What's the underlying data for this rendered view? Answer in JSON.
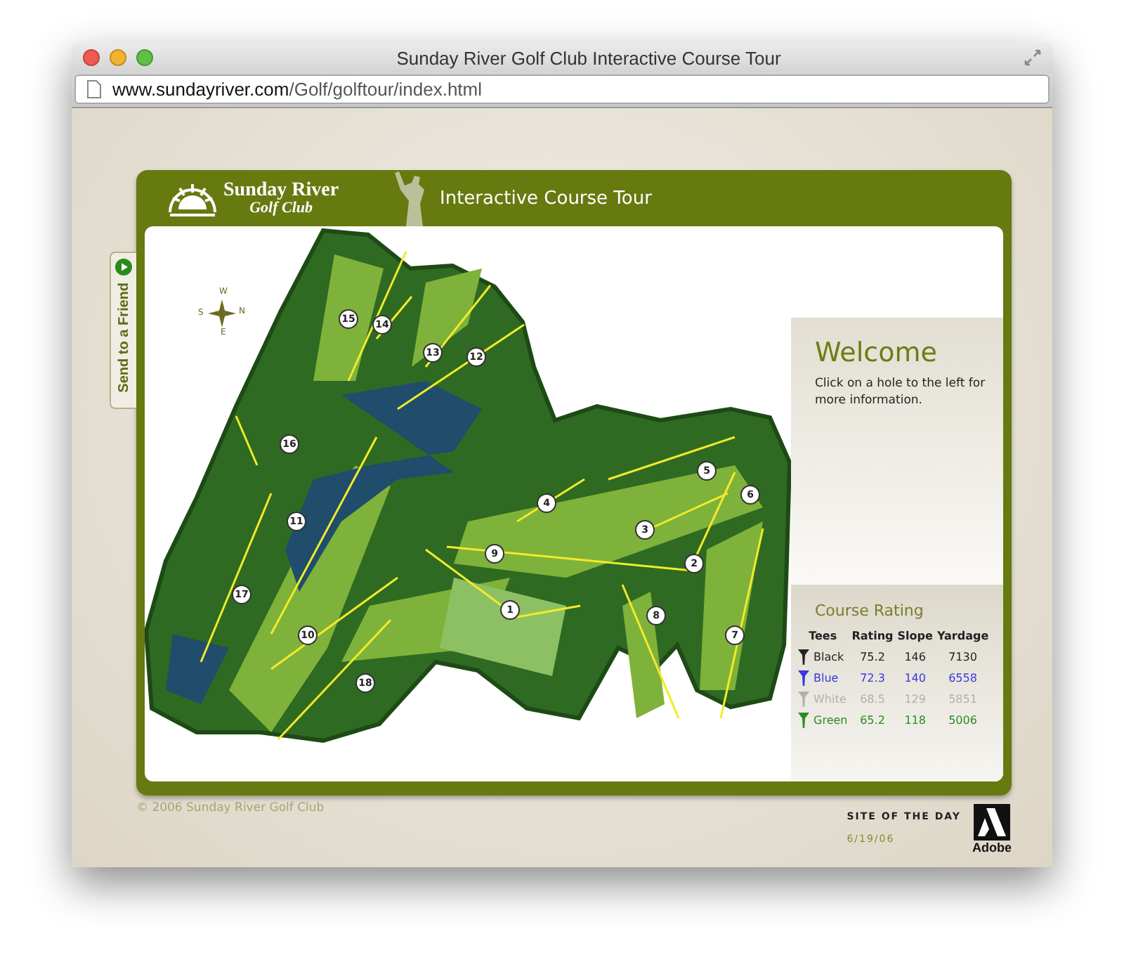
{
  "window": {
    "title": "Sunday River Golf Club Interactive Course Tour"
  },
  "address_bar": {
    "domain": "www.sundayriver.com",
    "path": "/Golf/golftour/index.html"
  },
  "header": {
    "logo_line1": "Sunday River",
    "logo_line2": "Golf Club",
    "title": "Interactive Course Tour"
  },
  "send_button": {
    "label": "Send to a Friend"
  },
  "map": {
    "compass": [
      "W",
      "N",
      "S",
      "E"
    ],
    "holes": [
      {
        "label": "15"
      },
      {
        "label": "14"
      },
      {
        "label": "13"
      },
      {
        "label": "12"
      },
      {
        "label": "16"
      },
      {
        "label": "11"
      },
      {
        "label": "17"
      },
      {
        "label": "10"
      },
      {
        "label": "18"
      },
      {
        "label": "1"
      },
      {
        "label": "9"
      },
      {
        "label": "4"
      },
      {
        "label": "3"
      },
      {
        "label": "2"
      },
      {
        "label": "5"
      },
      {
        "label": "6"
      },
      {
        "label": "8"
      },
      {
        "label": "7"
      }
    ]
  },
  "welcome": {
    "heading": "Welcome",
    "text": "Click on a hole to the left for more information."
  },
  "course_rating": {
    "title": "Course Rating",
    "columns": [
      "Tees",
      "Rating",
      "Slope",
      "Yardage"
    ],
    "rows": [
      {
        "tee": "Black",
        "rating": "75.2",
        "slope": "146",
        "yardage": "7130",
        "color": "#222222"
      },
      {
        "tee": "Blue",
        "rating": "72.3",
        "slope": "140",
        "yardage": "6558",
        "color": "#3838e0"
      },
      {
        "tee": "White",
        "rating": "68.5",
        "slope": "129",
        "yardage": "5851",
        "color": "#b0b0b0"
      },
      {
        "tee": "Green",
        "rating": "65.2",
        "slope": "118",
        "yardage": "5006",
        "color": "#2e8b22"
      }
    ]
  },
  "footer": {
    "copyright": "© 2006 Sunday River Golf Club",
    "award": "SITE OF THE DAY",
    "date": "6/19/06",
    "badge": "Adobe"
  }
}
